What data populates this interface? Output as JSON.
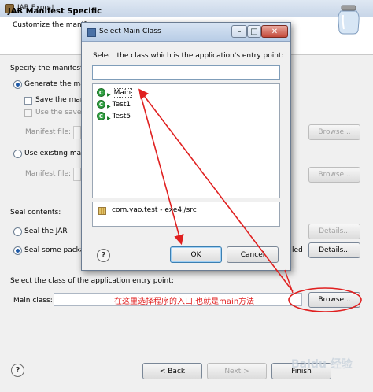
{
  "jar_window": {
    "title": "JAR Export",
    "heading": "JAR Manifest Specific",
    "description": "Customize the manife",
    "specify_label": "Specify the manifest:",
    "generate_option": "Generate the manif",
    "save_manifest": "Save the manife",
    "use_saved": "Use the saved",
    "manifest_file_label": "Manifest file:",
    "use_existing": "Use existing manif",
    "manifest_file_label_2": "Manifest file:",
    "browse_1": "Browse...",
    "browse_2": "Browse...",
    "seal_contents_label": "Seal contents:",
    "seal_jar": "Seal the JAR",
    "seal_some": "Seal some package",
    "sealed_suffix": "led",
    "details_1": "Details...",
    "details_2": "Details...",
    "entry_point_label": "Select the class of the application entry point:",
    "main_class_label": "Main class:",
    "main_class_browse": "Browse...",
    "back": "< Back",
    "next": "Next >",
    "finish": "Finish"
  },
  "dialog": {
    "title": "Select Main Class",
    "prompt": "Select the class which is the application's entry point:",
    "search_value": "",
    "classes": [
      {
        "label": "Main",
        "selected": true
      },
      {
        "label": "Test1",
        "selected": false
      },
      {
        "label": "Test5",
        "selected": false
      }
    ],
    "package": "com.yao.test - exe4j/src",
    "ok": "OK",
    "cancel": "Cancel"
  },
  "annotation": {
    "text": "在这里选择程序的入口,也就是main方法",
    "color": "#e02020"
  },
  "watermark": "Baidu 经验",
  "icons": {
    "help": "help-icon",
    "class": "class-run-icon",
    "package": "package-icon",
    "jar": "jar-icon"
  }
}
